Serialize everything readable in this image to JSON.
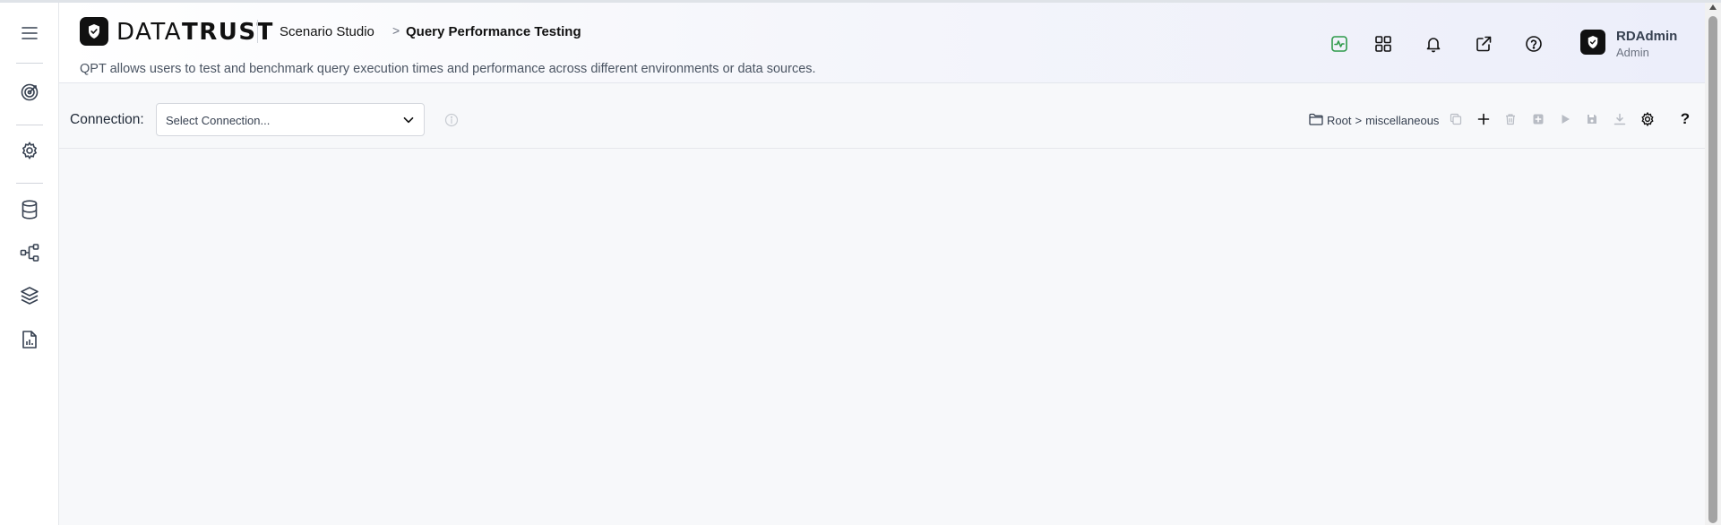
{
  "app": {
    "logo_light": "DATA",
    "logo_bold": "TRUST"
  },
  "breadcrumb": {
    "section": "Scenario Studio",
    "separator": ">",
    "page": "Query Performance Testing"
  },
  "description": "QPT allows users to test and benchmark query execution times and performance across different environments or data sources.",
  "user": {
    "name": "RDAdmin",
    "role": "Admin"
  },
  "header_icons": [
    "activity-icon",
    "apps-grid-icon",
    "bell-icon",
    "external-link-icon",
    "help-circle-icon"
  ],
  "sidebar_icons": [
    "menu-icon",
    "target-icon",
    "gear-icon",
    "database-icon",
    "workflow-icon",
    "layers-icon",
    "report-icon"
  ],
  "toolbar": {
    "connection_label": "Connection:",
    "connection_placeholder": "Select Connection...",
    "path_root": "Root",
    "path_separator": ">",
    "path_folder": "miscellaneous",
    "help_label": "?"
  },
  "toolbar_icons": [
    "copy-icon",
    "plus-icon",
    "trash-icon",
    "add-box-icon",
    "play-icon",
    "save-icon",
    "download-icon",
    "settings-icon",
    "help-icon"
  ],
  "colors": {
    "accent_green": "#2e9a4a",
    "icon_dark": "#374151",
    "icon_muted": "#b8bcc4"
  }
}
